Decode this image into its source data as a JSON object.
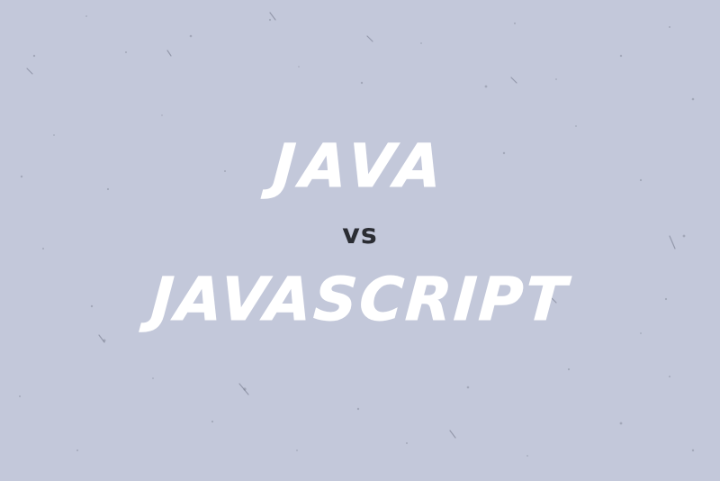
{
  "background_color": "#c3c8da",
  "heading": {
    "top_text": "JAVA",
    "middle_text": "vs",
    "bottom_text": "JAVASCRIPT",
    "text_color": "#ffffff",
    "vs_color": "#2b2d33"
  }
}
